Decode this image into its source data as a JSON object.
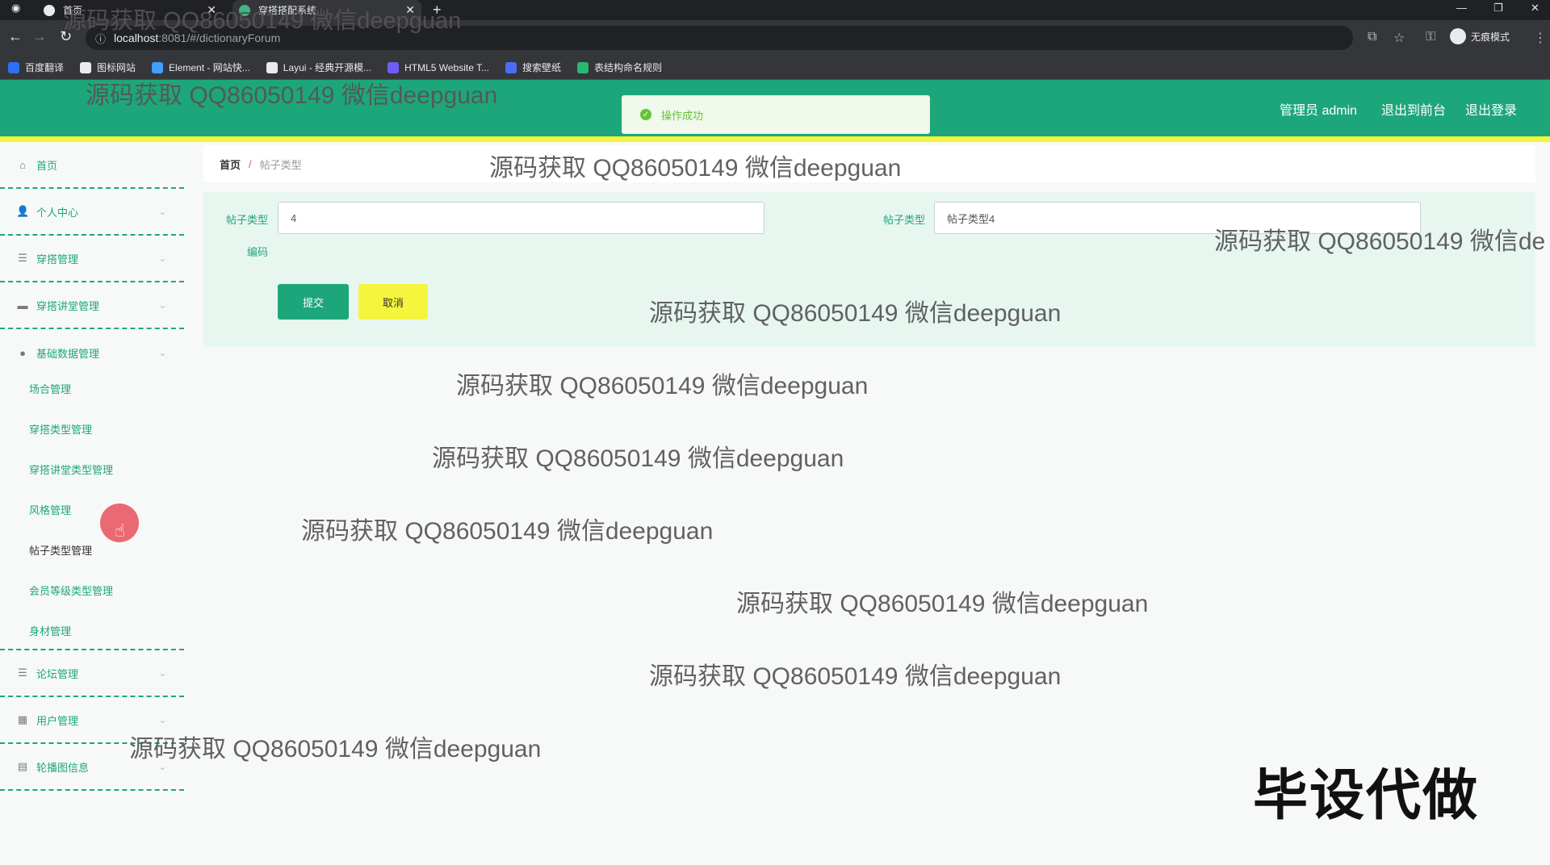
{
  "browser": {
    "tabs": [
      {
        "title": "首页",
        "active": false
      },
      {
        "title": "穿搭搭配系统",
        "active": true
      }
    ],
    "url_host": "localhost",
    "url_path": ":8081/#/dictionaryForum",
    "incognito_label": "无痕模式",
    "bookmarks": [
      {
        "label": "百度翻译",
        "color": "#2d6ff7"
      },
      {
        "label": "图标网站",
        "color": "#e8eaed"
      },
      {
        "label": "Element - 网站快...",
        "color": "#409eff"
      },
      {
        "label": "Layui - 经典开源模...",
        "color": "#e8eaed"
      },
      {
        "label": "HTML5 Website T...",
        "color": "#6d5ef5"
      },
      {
        "label": "搜索壁纸",
        "color": "#4a6cf7"
      },
      {
        "label": "表结构命名规则",
        "color": "#2bb673"
      }
    ]
  },
  "header": {
    "admin_label": "管理员 admin",
    "front_label": "退出到前台",
    "logout_label": "退出登录",
    "toast": "操作成功",
    "colors": {
      "primary": "#1ea67b",
      "accent": "#f5f53d"
    }
  },
  "sidebar": {
    "items": [
      {
        "label": "首页",
        "icon": "home-icon",
        "glyph": "⌂",
        "chevron": false
      },
      {
        "label": "个人中心",
        "icon": "user-icon",
        "glyph": "👤",
        "chevron": true
      },
      {
        "label": "穿搭管理",
        "icon": "menu-icon",
        "glyph": "☰",
        "chevron": true
      },
      {
        "label": "穿搭讲堂管理",
        "icon": "chat-icon",
        "glyph": "▬",
        "chevron": true
      },
      {
        "label": "基础数据管理",
        "icon": "pin-icon",
        "glyph": "●",
        "chevron": true
      }
    ],
    "sub_items": [
      {
        "label": "场合管理",
        "active": false
      },
      {
        "label": "穿搭类型管理",
        "active": false
      },
      {
        "label": "穿搭讲堂类型管理",
        "active": false
      },
      {
        "label": "风格管理",
        "active": false
      },
      {
        "label": "帖子类型管理",
        "active": true
      },
      {
        "label": "会员等级类型管理",
        "active": false
      },
      {
        "label": "身材管理",
        "active": false
      }
    ],
    "bottom_items": [
      {
        "label": "论坛管理",
        "icon": "list-icon",
        "glyph": "☰"
      },
      {
        "label": "用户管理",
        "icon": "grid-icon",
        "glyph": "▦"
      },
      {
        "label": "轮播图信息",
        "icon": "archive-icon",
        "glyph": "▤"
      }
    ]
  },
  "breadcrumb": {
    "home": "首页",
    "sep": "/",
    "current": "帖子类型"
  },
  "form": {
    "code_label_line1": "帖子类型",
    "code_label_line2": "编码",
    "code_value": "4",
    "name_label": "帖子类型",
    "name_value": "帖子类型4",
    "submit_label": "提交",
    "cancel_label": "取消"
  },
  "watermarks": {
    "text": "源码获取 QQ86050149 微信deepguan",
    "cut_text": "源码获取 QQ86050149 微信de",
    "overlay": "毕设代做"
  }
}
